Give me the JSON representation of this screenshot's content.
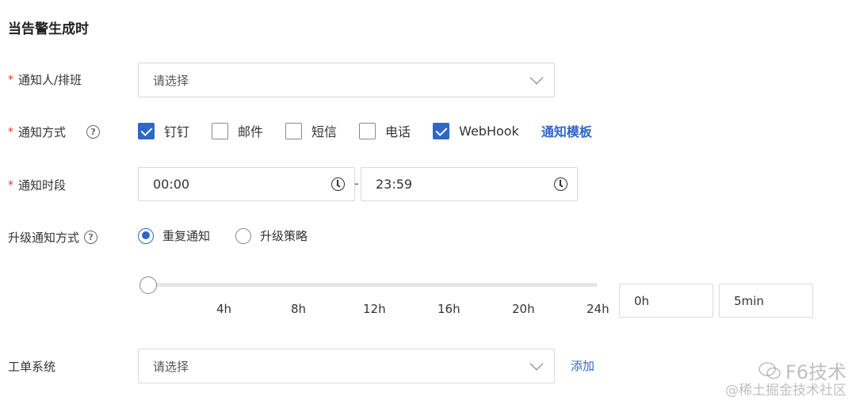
{
  "section": {
    "title": "当告警生成时"
  },
  "notify_person": {
    "label": "通知人/排班",
    "placeholder": "请选择"
  },
  "notify_method": {
    "label": "通知方式",
    "options": [
      {
        "label": "钉钉",
        "checked": true
      },
      {
        "label": "邮件",
        "checked": false
      },
      {
        "label": "短信",
        "checked": false
      },
      {
        "label": "电话",
        "checked": false
      },
      {
        "label": "WebHook",
        "checked": true
      }
    ],
    "template_link": "通知模板"
  },
  "notify_period": {
    "label": "通知时段",
    "start": "00:00",
    "separator": "-",
    "end": "23:59"
  },
  "escalation": {
    "label": "升级通知方式",
    "options": [
      {
        "label": "重复通知",
        "selected": true
      },
      {
        "label": "升级策略",
        "selected": false
      }
    ],
    "slider": {
      "value": 0,
      "ticks": [
        "4h",
        "8h",
        "12h",
        "16h",
        "20h",
        "24h"
      ]
    },
    "hours_value": "0h",
    "minutes_value": "5min"
  },
  "ticket_system": {
    "label": "工单系统",
    "placeholder": "请选择",
    "add_link": "添加"
  },
  "watermark": {
    "main": "F6技术",
    "sub": "@稀土掘金技术社区"
  },
  "colors": {
    "accent": "#2f66c9",
    "required": "#e0352b"
  }
}
